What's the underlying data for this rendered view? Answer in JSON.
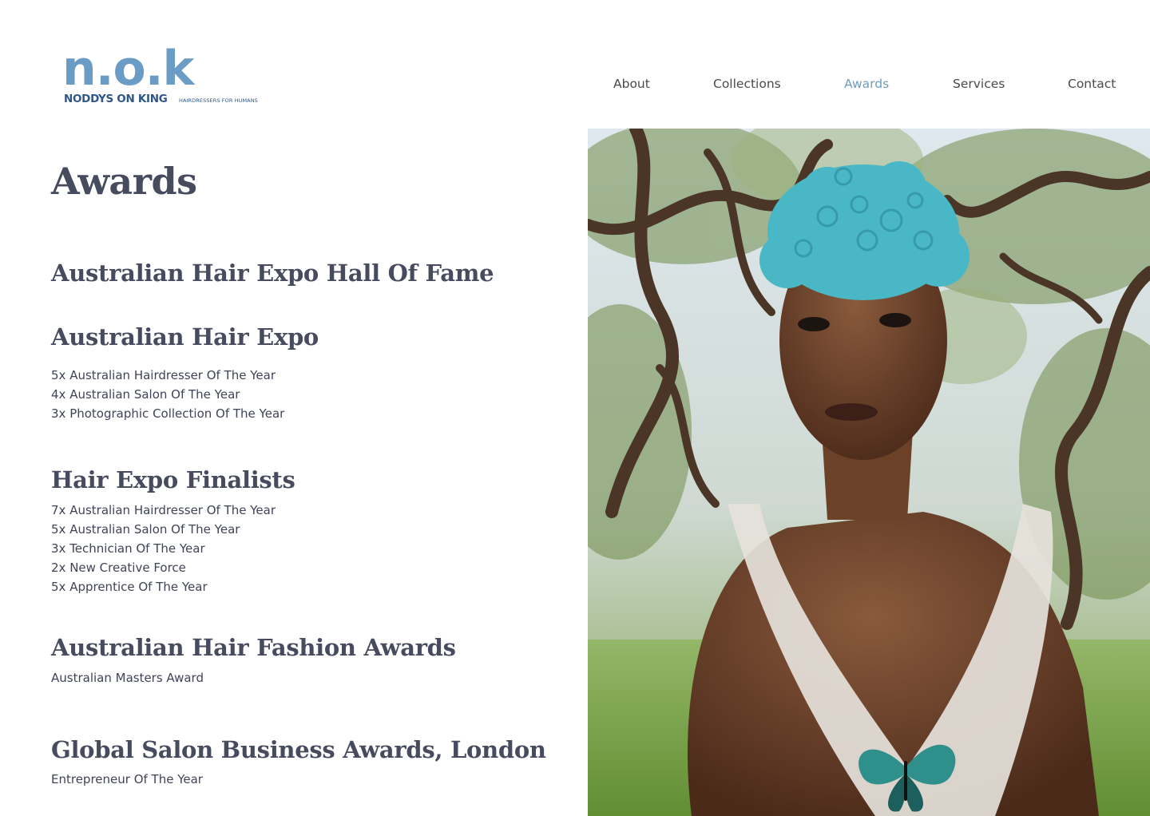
{
  "brand": {
    "mark": "n.o.k",
    "name": "NODDYS ON KING",
    "tagline": "HAIRDRESSERS FOR HUMANS"
  },
  "nav": {
    "items": [
      "About",
      "Collections",
      "Awards",
      "Services",
      "Contact"
    ],
    "active": "Awards"
  },
  "page": {
    "title": "Awards"
  },
  "sections": [
    {
      "heading": "Australian Hair Expo Hall Of Fame",
      "items": []
    },
    {
      "heading": "Australian Hair Expo",
      "items": [
        "5x Australian Hairdresser Of The Year",
        "4x Australian Salon Of The Year",
        "3x Photographic Collection Of The Year"
      ]
    },
    {
      "heading": "Hair Expo Finalists",
      "items": [
        "7x Australian Hairdresser Of The Year",
        "5x Australian Salon Of The Year",
        "3x Technician Of The Year",
        "2x New Creative Force",
        "5x Apprentice Of The Year"
      ]
    },
    {
      "heading": "Australian Hair Fashion Awards",
      "items": [
        "Australian Masters Award"
      ]
    },
    {
      "heading": "Global Salon Business Awards, London",
      "items": [
        "Entrepreneur Of The Year"
      ]
    }
  ],
  "colors": {
    "brand_blue": "#6a9cc6",
    "brand_navy": "#2f5688",
    "heading": "#464b5e",
    "nav_active": "#6e9dbf"
  }
}
